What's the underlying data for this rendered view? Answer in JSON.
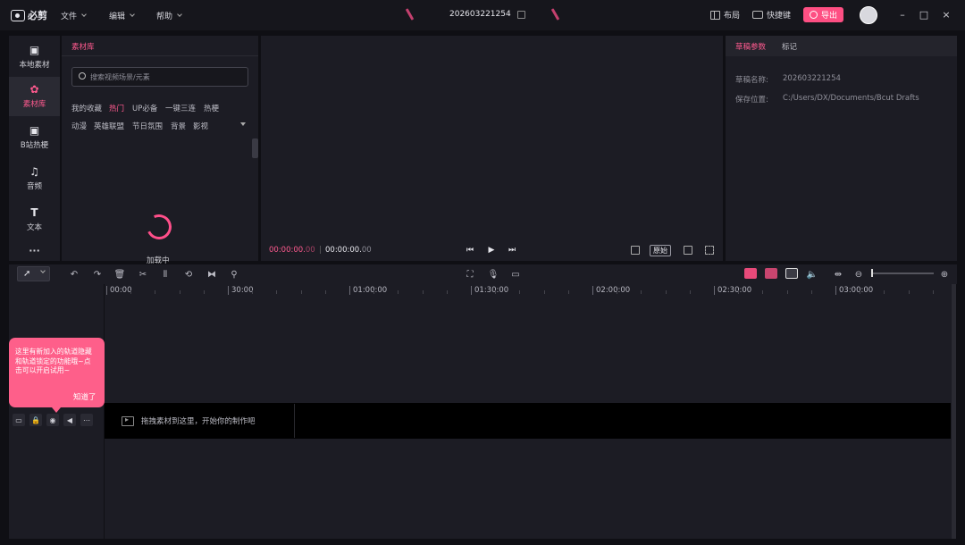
{
  "app": {
    "name": "必剪"
  },
  "menu": [
    {
      "label": "文件"
    },
    {
      "label": "编辑"
    },
    {
      "label": "帮助"
    }
  ],
  "draft_title": "202603221254",
  "titlebar_right": {
    "layout_label": "布局",
    "shortcut_label": "快捷键",
    "export_label": "导出"
  },
  "window_controls": {
    "minimize": "–",
    "maximize": "□",
    "close": "×"
  },
  "side_nav": [
    {
      "label": "本地素材",
      "icon": "folder-upload-icon"
    },
    {
      "label": "素材库",
      "icon": "material-reel-icon",
      "active": true
    },
    {
      "label": "B站热梗",
      "icon": "bilibili-tv-icon"
    },
    {
      "label": "音频",
      "icon": "music-note-icon"
    },
    {
      "label": "文本",
      "icon": "text-t-icon"
    },
    {
      "label": "···",
      "icon": "more-icon"
    }
  ],
  "library": {
    "tab": "素材库",
    "search_placeholder": "搜索视频场景/元素",
    "categories_row1": [
      "我的收藏",
      "热门",
      "UP必备",
      "一键三连",
      "热梗"
    ],
    "categories_row2": [
      "动漫",
      "英雄联盟",
      "节日氛围",
      "背景",
      "影视"
    ],
    "active_category": "热门",
    "loading_text": "加载中"
  },
  "preview": {
    "current_time_main": "00:00:00.",
    "current_time_frames": "00",
    "separator": "|",
    "total_time_main": "00:00:00.",
    "total_time_frames": "00",
    "original_label": "原始"
  },
  "params": {
    "tabs": [
      "草稿参数",
      "标记"
    ],
    "fields": [
      {
        "label": "草稿名称:",
        "value": "202603221254"
      },
      {
        "label": "保存位置:",
        "value": "C:/Users/DX/Documents/Bcut Drafts"
      }
    ]
  },
  "timeline": {
    "ruler": [
      "00:00",
      "30:00",
      "01:00:00",
      "01:30:00",
      "02:00:00",
      "02:30:00",
      "03:00:00"
    ],
    "drop_hint": "拖拽素材到这里，开始你的制作吧",
    "tooltip_text": "这里有新加入的轨道隐藏和轨道锁定的功能哦~点击可以开启试用~",
    "tooltip_button": "知道了"
  },
  "colors": {
    "accent": "#fe4f83",
    "panel": "#1c1c24",
    "background": "#0f0f14"
  }
}
